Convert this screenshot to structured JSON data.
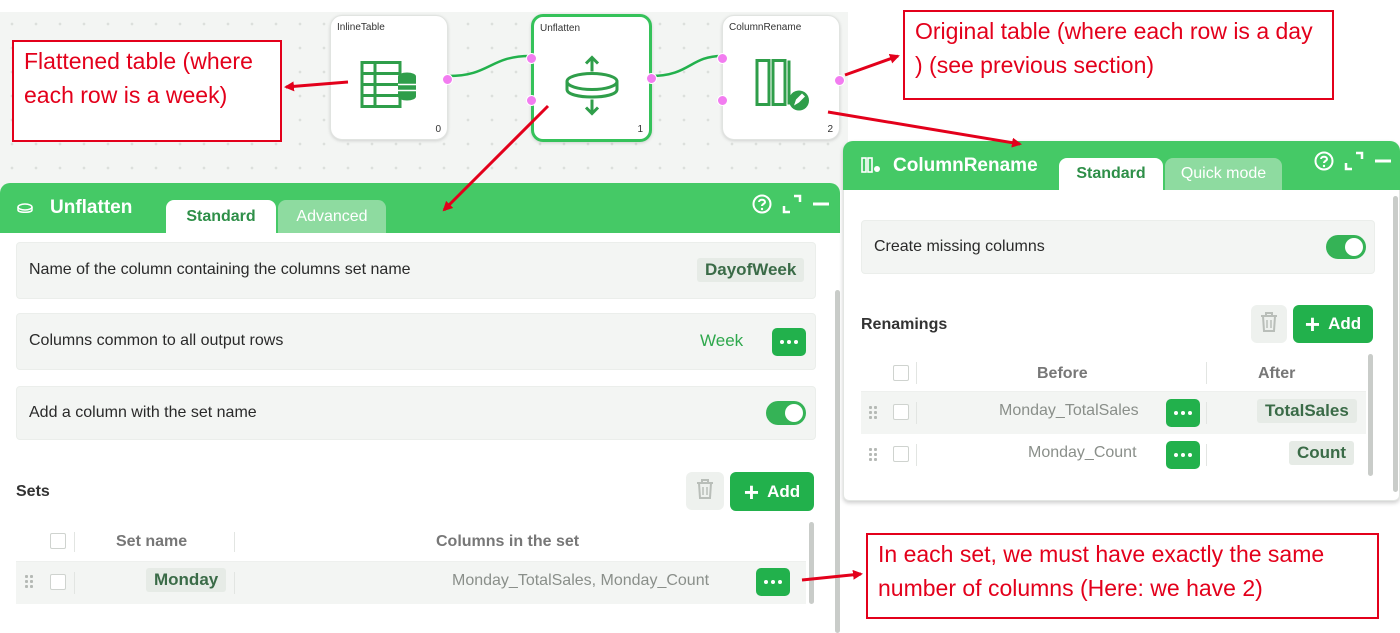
{
  "canvas": {
    "nodes": [
      {
        "label": "InlineTable",
        "index": "0",
        "icon": "table-database-icon"
      },
      {
        "label": "Unflatten",
        "index": "1",
        "icon": "unflatten-icon"
      },
      {
        "label": "ColumnRename",
        "index": "2",
        "icon": "column-rename-icon"
      }
    ]
  },
  "unflatten": {
    "title": "Unflatten",
    "tabs": [
      "Standard",
      "Advanced"
    ],
    "set_name_column_label": "Name of the column containing the columns set name",
    "set_name_column_value": "DayofWeek",
    "common_columns_label": "Columns common to all output rows",
    "common_columns_value": "Week",
    "add_column_label": "Add a column with the set name",
    "add_column_enabled": true,
    "sets_title": "Sets",
    "add_label": "Add",
    "grid_headers": [
      "Set name",
      "Columns in the set"
    ],
    "rows": [
      {
        "set_name": "Monday",
        "columns": "Monday_TotalSales, Monday_Count"
      }
    ]
  },
  "column_rename": {
    "title": "ColumnRename",
    "tabs": [
      "Standard",
      "Quick mode"
    ],
    "create_missing_label": "Create missing columns",
    "create_missing_enabled": true,
    "renamings_title": "Renamings",
    "add_label": "Add",
    "grid_headers": [
      "Before",
      "After"
    ],
    "rows": [
      {
        "before": "Monday_TotalSales",
        "after": "TotalSales"
      },
      {
        "before": "Monday_Count",
        "after": "Count"
      }
    ]
  },
  "annotations": {
    "flattened": "Flattened table (where each row is a week)",
    "original": "Original table (where each row is a day ) (see previous section)",
    "sets_note": "In each set, we must have exactly the same number of columns (Here: we have 2)"
  },
  "colors": {
    "accent": "#45c966",
    "button": "#22b14c",
    "annotation": "#e3001b",
    "port": "#f27cf0"
  }
}
